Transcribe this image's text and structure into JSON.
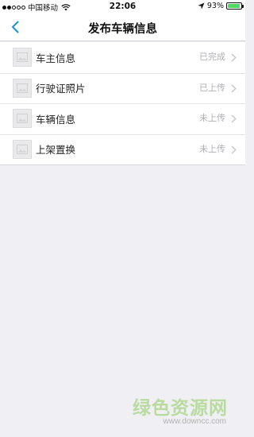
{
  "status_bar": {
    "carrier": "中国移动",
    "time": "22:06",
    "battery": "93%",
    "battery_level": 0.93,
    "signal_strength": 2,
    "icons": [
      "wifi-icon",
      "location-icon",
      "battery-icon"
    ]
  },
  "nav": {
    "title": "发布车辆信息",
    "back_icon": "chevron-left-icon",
    "accent_color": "#1a8fe3"
  },
  "list": {
    "items": [
      {
        "label": "车主信息",
        "status": "已完成"
      },
      {
        "label": "行驶证照片",
        "status": "已上传"
      },
      {
        "label": "车辆信息",
        "status": "未上传"
      },
      {
        "label": "上架置换",
        "status": "未上传"
      }
    ]
  },
  "watermark": {
    "text": "绿色资源网",
    "url": "www.downcc.com"
  }
}
